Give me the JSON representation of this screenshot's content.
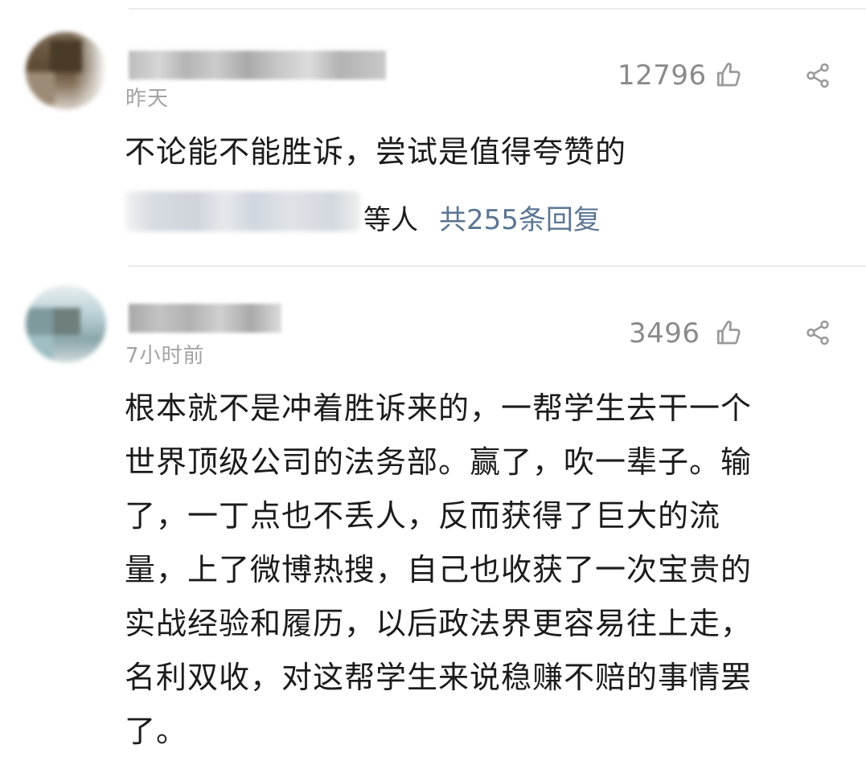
{
  "comments": [
    {
      "time": "昨天",
      "likes": "12796",
      "text": "不论能不能胜诉，尝试是值得夸赞的",
      "reply": {
        "suffix": "等人",
        "link": "共255条回复"
      }
    },
    {
      "time": "7小时前",
      "likes": "3496",
      "lines": [
        "根本就不是冲着胜诉来的，一帮学生去干一个",
        "世界顶级公司的法务部。赢了，吹一辈子。输",
        "了，一丁点也不丢人，反而获得了巨大的流",
        "量，上了微博热搜，自己也收获了一次宝贵的",
        "实战经验和履历，以后政法界更容易往上走，",
        "名利双收，对这帮学生来说稳赚不赔的事情罢",
        "了。"
      ]
    }
  ],
  "icons": {
    "like": "thumbs-up-icon",
    "share": "share-icon",
    "icon_color": "#9a9a9a"
  },
  "colors": {
    "link": "#5b7593",
    "meta": "#a3a3a3",
    "text": "#1b1b1b"
  }
}
